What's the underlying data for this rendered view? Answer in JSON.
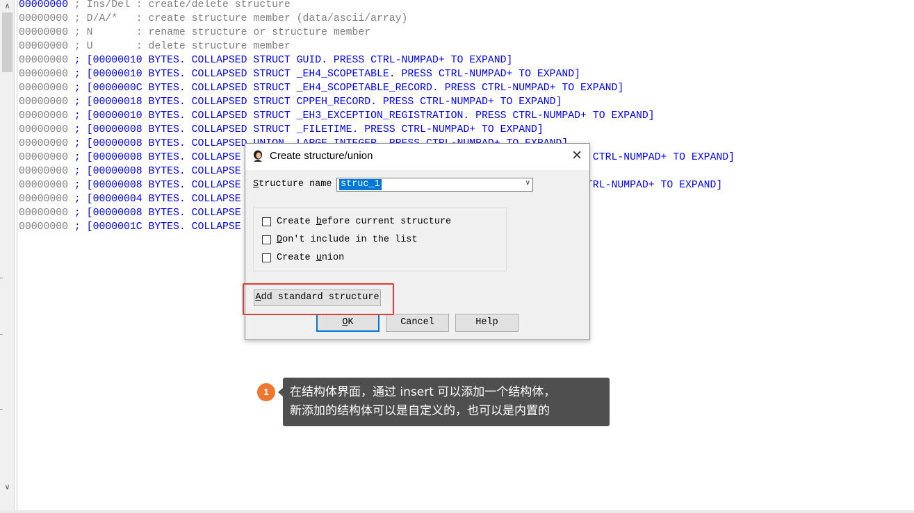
{
  "listing": {
    "lines": [
      {
        "addr": "00000000",
        "text": " ; Ins/Del : create/delete structure",
        "blue": false
      },
      {
        "addr": "00000000",
        "text": " ; D/A/*   : create structure member (data/ascii/array)",
        "blue": false
      },
      {
        "addr": "00000000",
        "text": " ; N       : rename structure or structure member",
        "blue": false
      },
      {
        "addr": "00000000",
        "text": " ; U       : delete structure member",
        "blue": false
      },
      {
        "addr": "00000000",
        "text": " ; [00000010 BYTES. COLLAPSED STRUCT GUID. PRESS CTRL-NUMPAD+ TO EXPAND]",
        "blue": true
      },
      {
        "addr": "00000000",
        "text": " ; [00000010 BYTES. COLLAPSED STRUCT _EH4_SCOPETABLE. PRESS CTRL-NUMPAD+ TO EXPAND]",
        "blue": true
      },
      {
        "addr": "00000000",
        "text": " ; [0000000C BYTES. COLLAPSED STRUCT _EH4_SCOPETABLE_RECORD. PRESS CTRL-NUMPAD+ TO EXPAND]",
        "blue": true
      },
      {
        "addr": "00000000",
        "text": " ; [00000018 BYTES. COLLAPSED STRUCT CPPEH_RECORD. PRESS CTRL-NUMPAD+ TO EXPAND]",
        "blue": true
      },
      {
        "addr": "00000000",
        "text": " ; [00000010 BYTES. COLLAPSED STRUCT _EH3_EXCEPTION_REGISTRATION. PRESS CTRL-NUMPAD+ TO EXPAND]",
        "blue": true
      },
      {
        "addr": "00000000",
        "text": " ; [00000008 BYTES. COLLAPSED STRUCT _FILETIME. PRESS CTRL-NUMPAD+ TO EXPAND]",
        "blue": true
      },
      {
        "addr": "00000000",
        "text": " ; [00000008 BYTES. COLLAPSED UNION _LARGE_INTEGER. PRESS CTRL-NUMPAD+ TO EXPAND]",
        "blue": true
      },
      {
        "addr": "00000000",
        "text": " ; [00000008 BYTES. COLLAPSE                                              74E. PRESS CTRL-NUMPAD+ TO EXPAND]",
        "blue": true
      },
      {
        "addr": "00000000",
        "text": " ; [00000008 BYTES. COLLAPSE",
        "blue": true
      },
      {
        "addr": "00000000",
        "text": " ; [00000008 BYTES. COLLAPSE                                             23. PRESS CTRL-NUMPAD+ TO EXPAND]",
        "blue": true
      },
      {
        "addr": "00000000",
        "text": " ; [00000004 BYTES. COLLAPSE                                             D]",
        "blue": true
      },
      {
        "addr": "00000000",
        "text": " ; [00000008 BYTES. COLLAPSE                                            AND]",
        "blue": true
      },
      {
        "addr": "00000000",
        "text": " ; [0000001C BYTES. COLLAPSE                                            TO EXPAND]",
        "blue": true
      }
    ]
  },
  "dialog": {
    "title": "Create structure/union",
    "close_glyph": "✕",
    "structure_name_label_u": "S",
    "structure_name_label_rest": "tructure name",
    "structure_name_value": "struc_1",
    "options": [
      {
        "pre": "Create ",
        "u": "b",
        "post": "efore current structure",
        "checked": false
      },
      {
        "pre": "",
        "u": "D",
        "post": "on't include in the list",
        "checked": false
      },
      {
        "pre": "Create ",
        "u": "u",
        "post": "nion",
        "checked": false
      }
    ],
    "add_standard_u": "A",
    "add_standard_rest": "dd standard structure",
    "ok_u": "O",
    "ok_rest": "K",
    "cancel_label": "Cancel",
    "help_label": "Help"
  },
  "annotation": {
    "step": "1",
    "line1": "在结构体界面，通过 insert 可以添加一个结构体，",
    "line2": "新添加的结构体可以是自定义的，也可以是内置的"
  },
  "colors": {
    "listing_blue": "#0000ff",
    "highlight_red": "#e53935",
    "badge_orange": "#f0772f",
    "callout_bg": "#4f4f4f"
  }
}
